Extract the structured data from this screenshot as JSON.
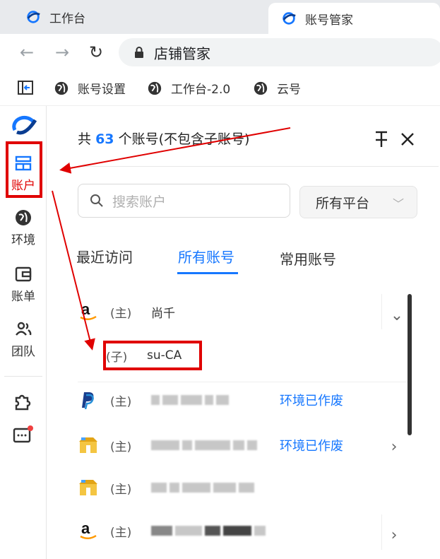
{
  "browser": {
    "tabs": [
      {
        "label": "工作台"
      },
      {
        "label": "账号管家"
      }
    ],
    "address": "店铺管家",
    "bookmarks": [
      {
        "label": "账号设置"
      },
      {
        "label": "工作台-2.0"
      },
      {
        "label": "云号"
      }
    ]
  },
  "sidebar": {
    "items": [
      {
        "label": "账户",
        "icon": "account-icon"
      },
      {
        "label": "环境",
        "icon": "globe-icon"
      },
      {
        "label": "账单",
        "icon": "wallet-icon"
      },
      {
        "label": "团队",
        "icon": "team-icon"
      }
    ]
  },
  "panel": {
    "title_prefix": "共",
    "count": "63",
    "title_suffix": "个账号(不包含子账号)",
    "search_placeholder": "搜索账户",
    "platform_select": "所有平台",
    "tabs": [
      "最近访问",
      "所有账号",
      "常用账号"
    ],
    "rows": [
      {
        "platform": "amazon",
        "role": "(主)",
        "name": "尚千",
        "status": ""
      },
      {
        "platform": "",
        "role": "(子)",
        "name": "su-CA",
        "status": ""
      },
      {
        "platform": "paypal",
        "role": "(主)",
        "name": "",
        "status": "环境已作废"
      },
      {
        "platform": "shop",
        "role": "(主)",
        "name": "",
        "status": "环境已作废"
      },
      {
        "platform": "shop",
        "role": "(主)",
        "name": "",
        "status": ""
      },
      {
        "platform": "amazon",
        "role": "(主)",
        "name": "",
        "status": ""
      }
    ]
  },
  "colors": {
    "accent": "#1677ff",
    "annotation": "#e00000"
  }
}
